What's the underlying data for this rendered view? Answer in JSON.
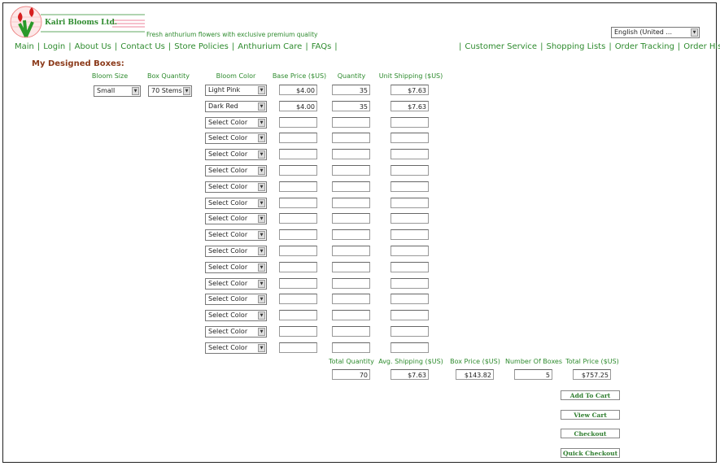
{
  "brand": {
    "name": "Kairi Blooms Ltd.",
    "tagline": "Fresh anthurium flowers with exclusive premium quality"
  },
  "language": {
    "selected": "English (United ..."
  },
  "nav_left": [
    "Main",
    "Login",
    "About Us",
    "Contact Us",
    "Store Policies",
    "Anthurium Care",
    "FAQs"
  ],
  "nav_right": [
    "Customer Service",
    "Shopping Lists",
    "Order Tracking",
    "Order History"
  ],
  "section_title": "My Designed Boxes:",
  "columns": {
    "bloom_size": "Bloom Size",
    "box_quantity": "Box Quantity",
    "bloom_color": "Bloom Color",
    "base_price": "Base Price ($US)",
    "quantity": "Quantity",
    "unit_shipping": "Unit Shipping ($US)"
  },
  "bloom_size": "Small",
  "box_quantity": "70 Stems",
  "rows": [
    {
      "color": "Light Pink",
      "base_price": "$4.00",
      "quantity": "35",
      "shipping": "$7.63"
    },
    {
      "color": "Dark Red",
      "base_price": "$4.00",
      "quantity": "35",
      "shipping": "$7.63"
    },
    {
      "color": "Select Color",
      "base_price": "",
      "quantity": "",
      "shipping": ""
    },
    {
      "color": "Select Color",
      "base_price": "",
      "quantity": "",
      "shipping": ""
    },
    {
      "color": "Select Color",
      "base_price": "",
      "quantity": "",
      "shipping": ""
    },
    {
      "color": "Select Color",
      "base_price": "",
      "quantity": "",
      "shipping": ""
    },
    {
      "color": "Select Color",
      "base_price": "",
      "quantity": "",
      "shipping": ""
    },
    {
      "color": "Select Color",
      "base_price": "",
      "quantity": "",
      "shipping": ""
    },
    {
      "color": "Select Color",
      "base_price": "",
      "quantity": "",
      "shipping": ""
    },
    {
      "color": "Select Color",
      "base_price": "",
      "quantity": "",
      "shipping": ""
    },
    {
      "color": "Select Color",
      "base_price": "",
      "quantity": "",
      "shipping": ""
    },
    {
      "color": "Select Color",
      "base_price": "",
      "quantity": "",
      "shipping": ""
    },
    {
      "color": "Select Color",
      "base_price": "",
      "quantity": "",
      "shipping": ""
    },
    {
      "color": "Select Color",
      "base_price": "",
      "quantity": "",
      "shipping": ""
    },
    {
      "color": "Select Color",
      "base_price": "",
      "quantity": "",
      "shipping": ""
    },
    {
      "color": "Select Color",
      "base_price": "",
      "quantity": "",
      "shipping": ""
    },
    {
      "color": "Select Color",
      "base_price": "",
      "quantity": "",
      "shipping": ""
    }
  ],
  "totals": {
    "labels": {
      "total_quantity": "Total Quantity",
      "avg_shipping": "Avg. Shipping ($US)",
      "box_price": "Box Price ($US)",
      "number_of_boxes": "Number Of Boxes",
      "total_price": "Total Price ($US)"
    },
    "values": {
      "total_quantity": "70",
      "avg_shipping": "$7.63",
      "box_price": "$143.82",
      "number_of_boxes": "5",
      "total_price": "$757.25"
    }
  },
  "buttons": {
    "add_to_cart": "Add To Cart",
    "view_cart": "View Cart",
    "checkout": "Checkout",
    "quick_checkout": "Quick Checkout"
  },
  "colors": {
    "accent_green": "#2e8b2e",
    "title_brown": "#8b3a1a",
    "logo_red": "#d62020"
  }
}
